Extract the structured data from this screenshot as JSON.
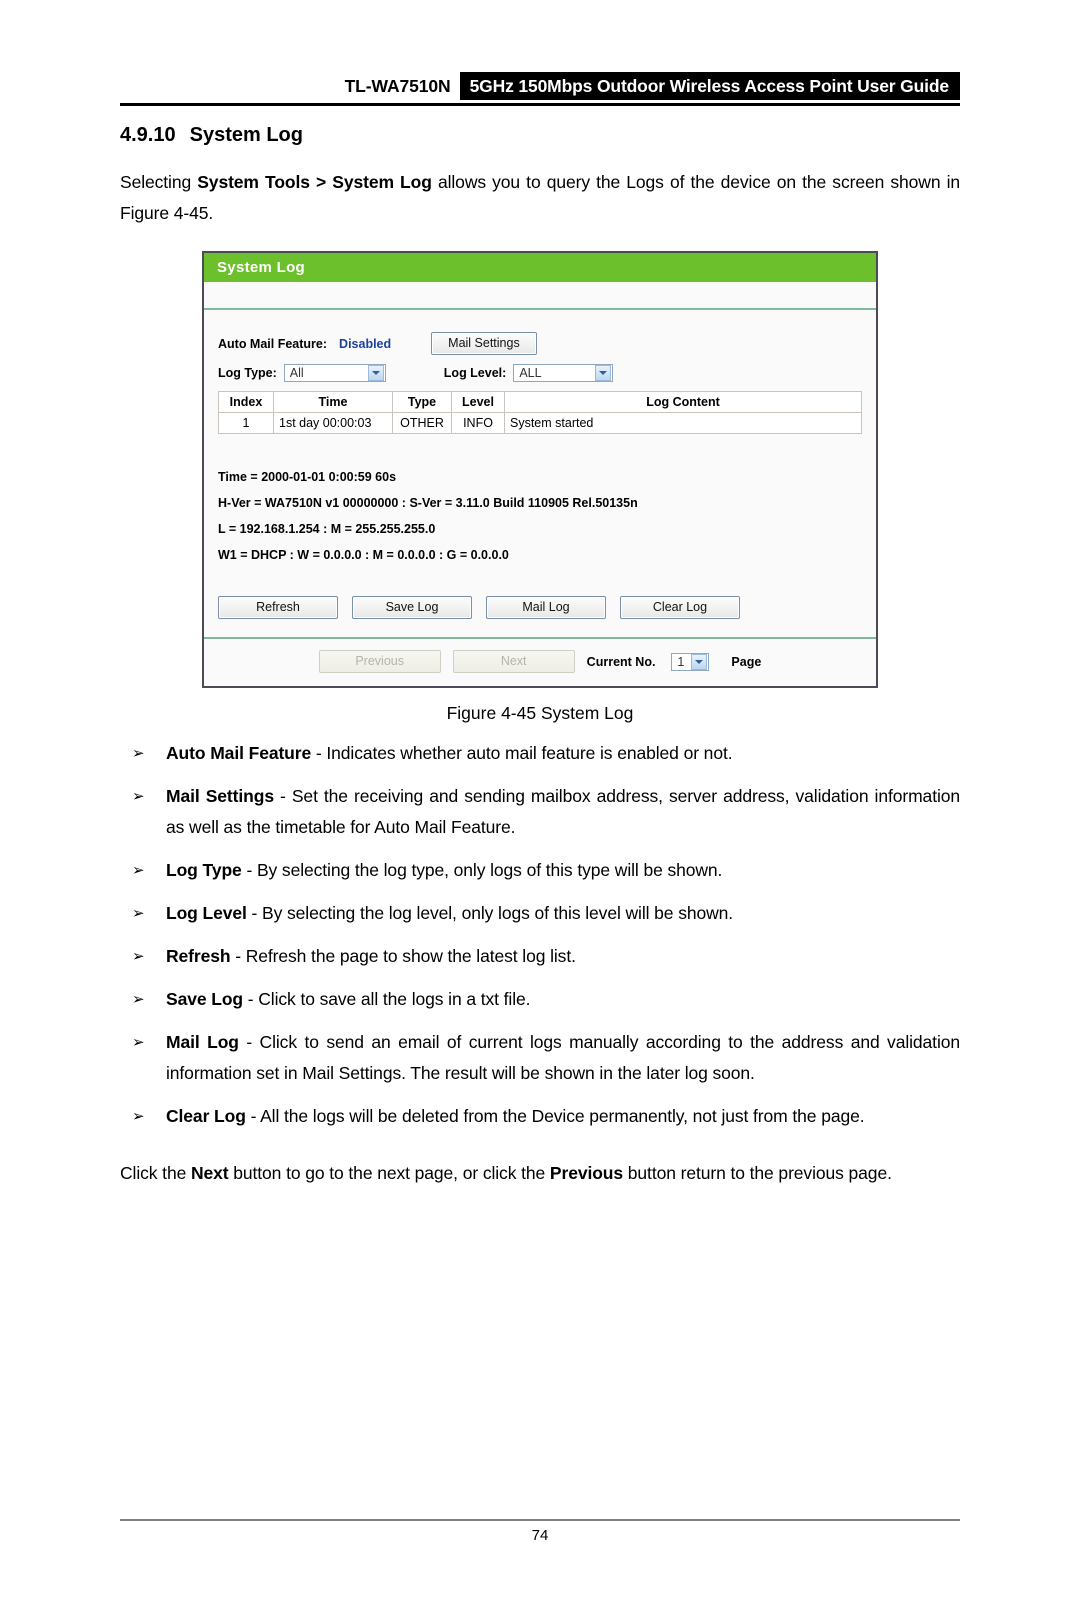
{
  "header": {
    "model": "TL-WA7510N",
    "band_title": "5GHz 150Mbps Outdoor Wireless Access Point User Guide"
  },
  "section": {
    "number": "4.9.10",
    "title": "System Log"
  },
  "intro": {
    "part1": "Selecting ",
    "bold1": "System Tools > System Log",
    "part2": " allows you to query the Logs of the device on the screen shown in Figure 4-45."
  },
  "figure": {
    "caption": "Figure 4-45 System Log",
    "panel_title": "System Log",
    "auto_mail_label": "Auto Mail Feature:",
    "auto_mail_value": "Disabled",
    "mail_settings_button": "Mail Settings",
    "log_type_label": "Log Type:",
    "log_type_value": "All",
    "log_level_label": "Log Level:",
    "log_level_value": "ALL",
    "table": {
      "columns": [
        "Index",
        "Time",
        "Type",
        "Level",
        "Log Content"
      ],
      "rows": [
        {
          "index": "1",
          "time": "1st day 00:00:03",
          "type": "OTHER",
          "level": "INFO",
          "content": "System started"
        }
      ]
    },
    "info_lines": [
      "Time = 2000-01-01 0:00:59 60s",
      "H-Ver = WA7510N v1 00000000 : S-Ver = 3.11.0 Build 110905 Rel.50135n",
      "L = 192.168.1.254 : M = 255.255.255.0",
      "W1 = DHCP : W = 0.0.0.0 : M = 0.0.0.0 : G = 0.0.0.0"
    ],
    "actions": {
      "refresh": "Refresh",
      "save_log": "Save Log",
      "mail_log": "Mail Log",
      "clear_log": "Clear Log"
    },
    "pagination": {
      "previous": "Previous",
      "next": "Next",
      "current_label": "Current No.",
      "current_value": "1",
      "page_label": "Page"
    },
    "colors": {
      "title_bar_green": "#6cc02c",
      "value_blue": "#1f3fa0",
      "separator_green": "#7fb89a"
    }
  },
  "bullets": [
    {
      "arrow": "➢",
      "term": "Auto Mail Feature",
      "desc": " - Indicates whether auto mail feature is enabled or not."
    },
    {
      "arrow": "➢",
      "term": "Mail Settings",
      "desc": " - Set the receiving and sending mailbox address, server address, validation information as well as the timetable for Auto Mail Feature."
    },
    {
      "arrow": "➢",
      "term": "Log Type",
      "desc": " - By selecting the log type, only logs of this type will be shown."
    },
    {
      "arrow": "➢",
      "term": "Log Level",
      "desc": " - By selecting the log level, only logs of this level will be shown."
    },
    {
      "arrow": "➢",
      "term": "Refresh",
      "desc": " - Refresh the page to show the latest log list."
    },
    {
      "arrow": "➢",
      "term": "Save Log",
      "desc": " - Click to save all the logs in a txt file."
    },
    {
      "arrow": "➢",
      "term": "Mail Log",
      "desc": " - Click to send an email of current logs manually according to the address and validation information set in Mail Settings. The result will be shown in the later log soon."
    },
    {
      "arrow": "➢",
      "term": "Clear Log",
      "desc": " - All the logs will be deleted from the Device permanently, not just from the page."
    }
  ],
  "closing": {
    "part1": "Click the ",
    "bold1": "Next",
    "part2": " button to go to the next page, or click the ",
    "bold2": "Previous",
    "part3": " button return to the previous page."
  },
  "footer": {
    "page_number": "74"
  }
}
